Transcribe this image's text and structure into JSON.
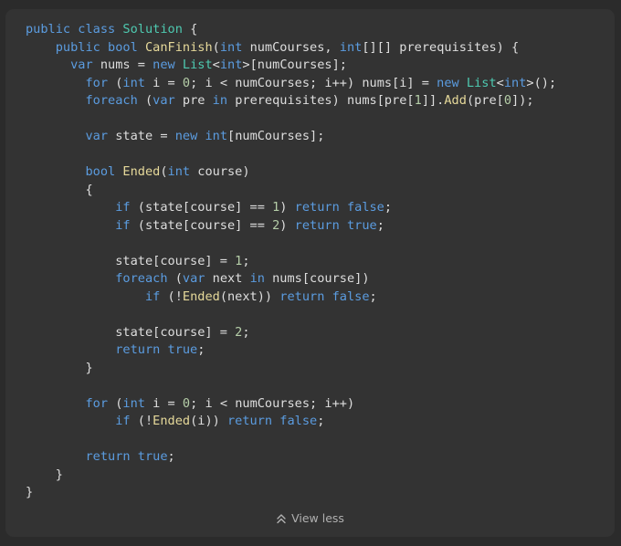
{
  "code_block": {
    "language": "csharp",
    "colors": {
      "keyword": "#5b9ce0",
      "type": "#4ec9b0",
      "method": "#e6d99a",
      "number": "#b5cea8",
      "text": "#dedede"
    },
    "lines": [
      [
        [
          "kw",
          "public class "
        ],
        [
          "type",
          "Solution"
        ],
        [
          "txt",
          " {"
        ]
      ],
      [
        [
          "txt",
          "    "
        ],
        [
          "kw",
          "public bool "
        ],
        [
          "fn",
          "CanFinish"
        ],
        [
          "txt",
          "("
        ],
        [
          "kw",
          "int"
        ],
        [
          "txt",
          " numCourses, "
        ],
        [
          "kw",
          "int"
        ],
        [
          "txt",
          "[][] prerequisites) {"
        ]
      ],
      [
        [
          "txt",
          "      "
        ],
        [
          "kw",
          "var"
        ],
        [
          "txt",
          " nums = "
        ],
        [
          "kw",
          "new "
        ],
        [
          "type",
          "List"
        ],
        [
          "txt",
          "<"
        ],
        [
          "kw",
          "int"
        ],
        [
          "txt",
          ">[numCourses];"
        ]
      ],
      [
        [
          "txt",
          "        "
        ],
        [
          "kw",
          "for"
        ],
        [
          "txt",
          " ("
        ],
        [
          "kw",
          "int"
        ],
        [
          "txt",
          " i = "
        ],
        [
          "num",
          "0"
        ],
        [
          "txt",
          "; i < numCourses; i++) nums[i] = "
        ],
        [
          "kw",
          "new "
        ],
        [
          "type",
          "List"
        ],
        [
          "txt",
          "<"
        ],
        [
          "kw",
          "int"
        ],
        [
          "txt",
          ">();"
        ]
      ],
      [
        [
          "txt",
          "        "
        ],
        [
          "kw",
          "foreach"
        ],
        [
          "txt",
          " ("
        ],
        [
          "kw",
          "var"
        ],
        [
          "txt",
          " pre "
        ],
        [
          "kw",
          "in"
        ],
        [
          "txt",
          " prerequisites) nums[pre["
        ],
        [
          "num",
          "1"
        ],
        [
          "txt",
          "]]."
        ],
        [
          "fn",
          "Add"
        ],
        [
          "txt",
          "(pre["
        ],
        [
          "num",
          "0"
        ],
        [
          "txt",
          "]);"
        ]
      ],
      [],
      [
        [
          "txt",
          "        "
        ],
        [
          "kw",
          "var"
        ],
        [
          "txt",
          " state = "
        ],
        [
          "kw",
          "new int"
        ],
        [
          "txt",
          "[numCourses];"
        ]
      ],
      [],
      [
        [
          "txt",
          "        "
        ],
        [
          "kw",
          "bool "
        ],
        [
          "fn",
          "Ended"
        ],
        [
          "txt",
          "("
        ],
        [
          "kw",
          "int"
        ],
        [
          "txt",
          " course)"
        ]
      ],
      [
        [
          "txt",
          "        {"
        ]
      ],
      [
        [
          "txt",
          "            "
        ],
        [
          "kw",
          "if"
        ],
        [
          "txt",
          " (state[course] == "
        ],
        [
          "num",
          "1"
        ],
        [
          "txt",
          ") "
        ],
        [
          "kw",
          "return false"
        ],
        [
          "txt",
          ";"
        ]
      ],
      [
        [
          "txt",
          "            "
        ],
        [
          "kw",
          "if"
        ],
        [
          "txt",
          " (state[course] == "
        ],
        [
          "num",
          "2"
        ],
        [
          "txt",
          ") "
        ],
        [
          "kw",
          "return true"
        ],
        [
          "txt",
          ";"
        ]
      ],
      [],
      [
        [
          "txt",
          "            state[course] = "
        ],
        [
          "num",
          "1"
        ],
        [
          "txt",
          ";"
        ]
      ],
      [
        [
          "txt",
          "            "
        ],
        [
          "kw",
          "foreach"
        ],
        [
          "txt",
          " ("
        ],
        [
          "kw",
          "var"
        ],
        [
          "txt",
          " next "
        ],
        [
          "kw",
          "in"
        ],
        [
          "txt",
          " nums[course])"
        ]
      ],
      [
        [
          "txt",
          "                "
        ],
        [
          "kw",
          "if"
        ],
        [
          "txt",
          " (!"
        ],
        [
          "fn",
          "Ended"
        ],
        [
          "txt",
          "(next)) "
        ],
        [
          "kw",
          "return false"
        ],
        [
          "txt",
          ";"
        ]
      ],
      [],
      [
        [
          "txt",
          "            state[course] = "
        ],
        [
          "num",
          "2"
        ],
        [
          "txt",
          ";"
        ]
      ],
      [
        [
          "txt",
          "            "
        ],
        [
          "kw",
          "return true"
        ],
        [
          "txt",
          ";"
        ]
      ],
      [
        [
          "txt",
          "        }"
        ]
      ],
      [],
      [
        [
          "txt",
          "        "
        ],
        [
          "kw",
          "for"
        ],
        [
          "txt",
          " ("
        ],
        [
          "kw",
          "int"
        ],
        [
          "txt",
          " i = "
        ],
        [
          "num",
          "0"
        ],
        [
          "txt",
          "; i < numCourses; i++)"
        ]
      ],
      [
        [
          "txt",
          "            "
        ],
        [
          "kw",
          "if"
        ],
        [
          "txt",
          " (!"
        ],
        [
          "fn",
          "Ended"
        ],
        [
          "txt",
          "(i)) "
        ],
        [
          "kw",
          "return false"
        ],
        [
          "txt",
          ";"
        ]
      ],
      [],
      [
        [
          "txt",
          "        "
        ],
        [
          "kw",
          "return true"
        ],
        [
          "txt",
          ";"
        ]
      ],
      [
        [
          "txt",
          "    }"
        ]
      ],
      [
        [
          "txt",
          "}"
        ]
      ]
    ]
  },
  "toggle": {
    "label": "View less",
    "icon": "double-chevron-up-icon"
  }
}
